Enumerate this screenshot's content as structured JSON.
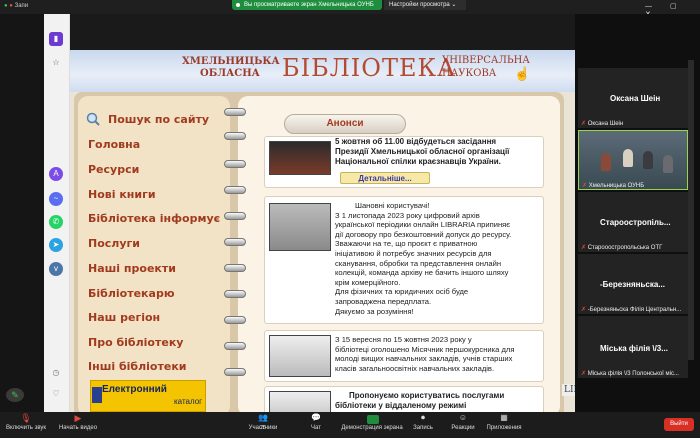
{
  "top_bar": {
    "shared_banner": "Вы просматриваете экран Хмельницька ОУНБ",
    "view_options": "Настройки просмотра",
    "left_label": "Запи"
  },
  "website": {
    "banner": {
      "left_top": "ХМЕЛЬНИЦЬКА",
      "left_bottom": "ОБЛАСНА",
      "main": "БІБЛІОТЕКА",
      "right_top": "УНІВЕРСАЛЬНА",
      "right_bottom": "НАУКОВА"
    },
    "menu": [
      "Пошук по сайту",
      "Головна",
      "Ресурси",
      "Нові книги",
      "Бібліотека інформує",
      "Послуги",
      "Наші проекти",
      "Бібліотекарю",
      "Наш регіон",
      "Про бібліотеку",
      "Інші бібліотеки"
    ],
    "catalog": {
      "label": "Електронний",
      "sub": "каталог"
    },
    "announcements_title": "Анонси",
    "news": [
      {
        "lines": [
          "5 жовтня об 11.00 відбудеться засідання",
          "Президії Хмельницької обласної організації",
          "Національної спілки краєзнавців України."
        ],
        "more": "Детальніше..."
      },
      {
        "lines": [
          "Шановні користувачі!",
          "З 1 листопада 2023 року цифровий архів",
          "української періодики онлайн LIBRARIA припиняє",
          "дії договору про безкоштовний допуск до ресурсу.",
          "Зважаючи на те, що проєкт є приватною",
          "ініціативою й потребує значних ресурсів для",
          "сканування, обробки та представлення онлайн",
          "колекцій, команда архіву не бачить іншого шляху",
          "крім комерційного.",
          "Для фізичних та юридичних осіб буде",
          "запроваджена передплата.",
          "Дякуємо за розуміння!"
        ]
      },
      {
        "lines": [
          "З 15 вересня по 15 жовтня 2023 року у",
          "бібліотеці оголошено Місячник першокурсника для",
          "молоді вищих навчальних закладів, учнів старших",
          "класів загальноосвітніх навчальних закладів."
        ]
      },
      {
        "lines": [
          "Пропонуємо користуватись послугами",
          "бібліотеки у віддаленому режимі"
        ]
      }
    ],
    "side_partial": "LIBRARIA"
  },
  "participants_panel": {
    "tiles": [
      {
        "big": "Оксана Шеін",
        "small": "Оксана Шеін"
      },
      {
        "big": "",
        "small": "Хмельницька ОУНБ"
      },
      {
        "big": "Староостропіль...",
        "small": "Старооостропольська ОТГ"
      },
      {
        "big": "-Березняньска...",
        "small": "-Березняньска Філія Центральн..."
      },
      {
        "big": "Міська філія \\/3...",
        "small": "Міська філія \\/3 Полонської міс..."
      }
    ]
  },
  "toolbar": {
    "items": [
      {
        "label": "Включить звук"
      },
      {
        "label": "Начать видео"
      },
      {
        "label": "Участники",
        "count": "25"
      },
      {
        "label": "Чат"
      },
      {
        "label": "Демонстрация экрана"
      },
      {
        "label": "Запись"
      },
      {
        "label": "Реакции"
      },
      {
        "label": "Приложения"
      }
    ],
    "leave": "Выйти"
  },
  "colors": {
    "accent_green": "#1e8e3e",
    "leave_red": "#d93025",
    "menu_text": "#a13b1f"
  }
}
